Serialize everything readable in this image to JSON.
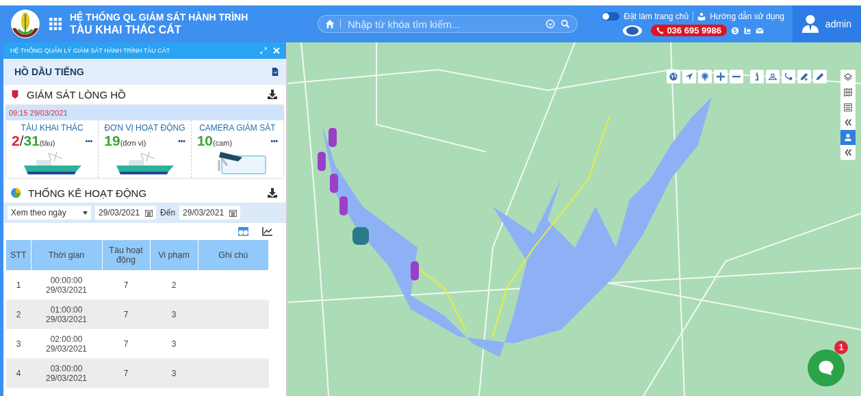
{
  "header": {
    "title_line1": "HỆ THỐNG QL GIÁM SÁT HÀNH TRÌNH",
    "title_line2": "TÀU KHAI THÁC CÁT",
    "search": {
      "placeholder": "Nhập từ khóa tìm kiếm..."
    },
    "home_toggle": {
      "label": "Đặt làm trang chủ",
      "on": false
    },
    "guide": "Hướng dẫn sử dụng",
    "phone": "036 695 9986",
    "user": "admin"
  },
  "panel": {
    "title": "HỆ THỐNG QUẢN LÝ GIÁM SÁT HÀNH TRÌNH TÀU CÁT",
    "region": "HỒ DẦU TIẾNG",
    "monitor": {
      "title": "GIÁM SÁT LÒNG HỒ",
      "timestamp": "09:15 29/03/2021",
      "stats": [
        {
          "kind": "ship",
          "label": "TÀU KHAI THÁC",
          "active": "2",
          "sep": "/",
          "total": "31",
          "unit": "(tàu)",
          "more": "•••"
        },
        {
          "kind": "ship",
          "label": "ĐƠN VỊ HOẠT ĐỘNG",
          "total": "19",
          "unit": "(đơn vị)",
          "more": "•••"
        },
        {
          "kind": "camera",
          "label": "CAMERA GIÁM SÁT",
          "total": "10",
          "unit": "(cam)",
          "more": "•••"
        }
      ]
    },
    "activity": {
      "title": "THỐNG KÊ HOẠT ĐỘNG",
      "view": "Xem theo ngày",
      "from": "29/03/2021",
      "to_label": "Đến",
      "to": "29/03/2021",
      "views": [
        {
          "kind": "table",
          "selected": true
        },
        {
          "kind": "chart",
          "selected": false
        }
      ],
      "columns": [
        "STT",
        "Thời gian",
        "Tàu hoạt động",
        "Vi phạm",
        "Ghi chú"
      ],
      "rows": [
        [
          "1",
          "00:00:00 29/03/2021",
          "7",
          "2"
        ],
        [
          "2",
          "01:00:00 29/03/2021",
          "7",
          "3"
        ],
        [
          "3",
          "02:00:00 29/03/2021",
          "7",
          "3"
        ],
        [
          "4",
          "03:00:00 29/03/2021",
          "7",
          "3"
        ]
      ]
    }
  },
  "map": {
    "side_tools": [
      {
        "kind": "layers",
        "selected": false
      },
      {
        "kind": "map",
        "selected": false
      },
      {
        "kind": "list",
        "selected": false
      },
      {
        "kind": "collapse",
        "selected": false
      },
      {
        "kind": "person",
        "selected": true
      },
      {
        "kind": "collapse",
        "selected": false
      }
    ],
    "chat_badge": "1"
  }
}
